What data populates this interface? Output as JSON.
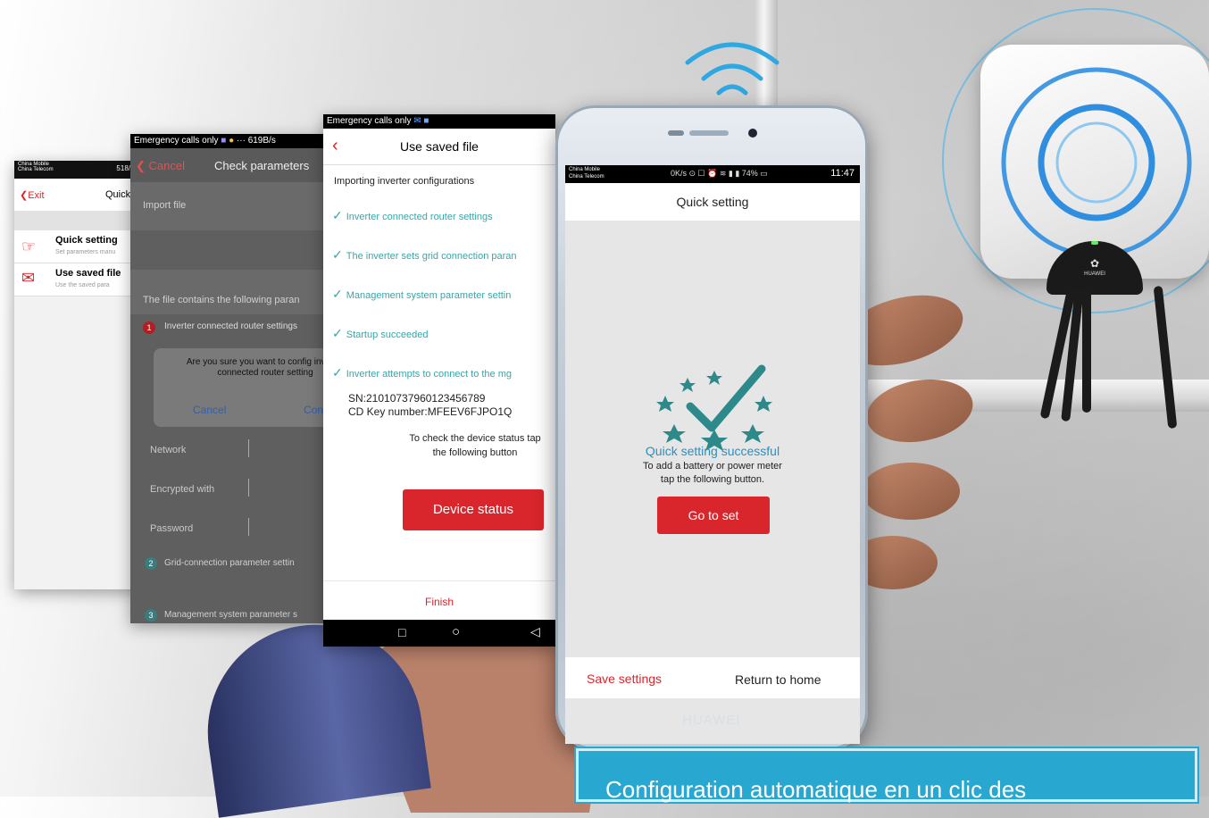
{
  "screen1": {
    "status_carrier1": "China Mobile",
    "status_carrier2": "China Telecom",
    "status_speed": "518/s",
    "exit_label": "Exit",
    "title": "Quick",
    "quick_setting_title": "Quick setting",
    "quick_setting_sub": "Set parameters manu",
    "saved_file_title": "Use saved file",
    "saved_file_sub": "Use the saved para"
  },
  "screen2": {
    "status_text": "Emergency calls only",
    "status_speed": "619B/s",
    "cancel_label": "Cancel",
    "title": "Check parameters",
    "import_file": "Import file",
    "contains_text": "The file contains the following paran",
    "section1": "Inverter connected router settings",
    "dialog_text": "Are you sure you want to config inverter connected router setting",
    "dialog_cancel": "Cancel",
    "dialog_confirm": "Con",
    "network_label": "Network",
    "encrypted_label": "Encrypted with",
    "password_label": "Password",
    "section2": "Grid-connection parameter settin",
    "section3": "Management system parameter s",
    "badge1": "1",
    "badge2": "2",
    "badge3": "3"
  },
  "screen3": {
    "status_text": "Emergency calls only",
    "title": "Use saved file",
    "importing": "Importing inverter configurations",
    "steps": [
      "Inverter connected router settings",
      "The inverter sets grid connection paran",
      "Management system parameter settin",
      "Startup succeeded",
      "Inverter attempts to connect to the mg"
    ],
    "sn": "SN:21010737960123456789",
    "cd_key": "CD Key number:MFEEV6FJPO1Q",
    "check_text": "To check the device status tap the following button",
    "device_status_btn": "Device status",
    "finish": "Finish"
  },
  "phone": {
    "status_carrier1": "China Mobile",
    "status_carrier2": "China Telecom",
    "status_icons": "0K/s ⊙ ☐ ⏰ ≋ ▮ ▮ 74% ▭",
    "time": "11:47",
    "title": "Quick setting",
    "success": "Quick setting successful",
    "hint": "To add a battery or power meter tap the following button.",
    "go_btn": "Go to set",
    "save_settings": "Save settings",
    "return_home": "Return to home",
    "brand": "HUAWEI"
  },
  "inverter": {
    "brand": "HUAWEI"
  },
  "caption": "Configuration automatique en un clic des",
  "colors": {
    "accent_red": "#d8262c",
    "check_teal": "#3aa6a6",
    "success_blue": "#2b8fc0",
    "caption_blue": "#28a8d1"
  }
}
